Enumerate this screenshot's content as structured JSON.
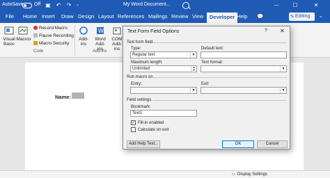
{
  "titlebar": {
    "autosave_label": "AutoSave",
    "autosave_state": "Off",
    "doc_title": "My Word Document...",
    "save_icon": "save-icon",
    "undo_icon": "undo-icon",
    "redo_icon": "redo-icon",
    "search_icon": "search-icon",
    "window_buttons": [
      "minimize-icon",
      "maximize-icon",
      "close-icon"
    ]
  },
  "tabs": [
    "File",
    "Home",
    "Insert",
    "Draw",
    "Design",
    "Layout",
    "References",
    "Mailings",
    "Review",
    "View",
    "Developer",
    "Help"
  ],
  "active_tab": "Developer",
  "editing_button": "Editing",
  "ribbon": {
    "code_group": {
      "label": "Code",
      "visual_basic": "Visual\nBasic",
      "macros": "Macros",
      "record_macro": "Record Macro",
      "pause_recording": "Pause Recording",
      "macro_security": "Macro Security"
    },
    "addins_group": {
      "label": "Add-ins",
      "add_ins": "Add-\nins",
      "word_add_ins": "Word\nAdd-ins",
      "com_add_ins": "COM\nAdd-ins"
    }
  },
  "document": {
    "name_label": "Name:"
  },
  "statusbar": {
    "display_settings": "Display Settings"
  },
  "dialog": {
    "title": "Text Form Field Options",
    "help": "?",
    "close": "✕",
    "section_text_form_field": "Text form field",
    "type_label": "Type:",
    "type_value": "Regular text",
    "default_text_label": "Default text:",
    "default_text_value": "",
    "max_length_label": "Maximum length:",
    "max_length_value": "Unlimited",
    "text_format_label": "Text format:",
    "text_format_value": "",
    "section_run_macro": "Run macro on",
    "entry_label": "Entry:",
    "exit_label": "Exit:",
    "section_field_settings": "Field settings",
    "bookmark_label": "Bookmark:",
    "bookmark_value": "Text1",
    "fill_in_enabled": "Fill-in enabled",
    "fill_in_checked": true,
    "calculate_on_exit": "Calculate on exit",
    "calculate_checked": false,
    "add_help_text": "Add Help Text...",
    "ok": "OK",
    "cancel": "Cancel"
  },
  "colors": {
    "ribbon_blue": "#1f5bb5",
    "dialog_bg": "#f0f0f0",
    "form_field_shading": "#b3b3b3"
  }
}
